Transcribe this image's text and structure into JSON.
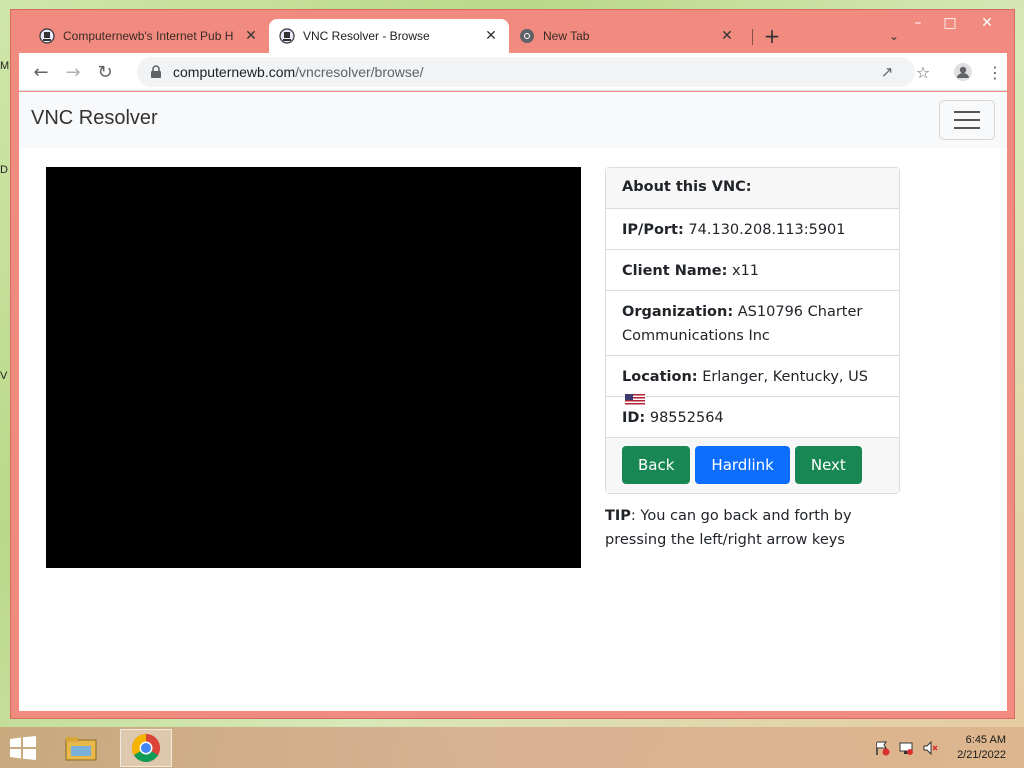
{
  "browser": {
    "tabs": [
      {
        "title": "Computernewb's Internet Pub H",
        "icon": "computernewb-icon",
        "active": false
      },
      {
        "title": "VNC Resolver - Browse",
        "icon": "computernewb-icon",
        "active": true
      },
      {
        "title": "New Tab",
        "icon": "chrome-icon",
        "active": false
      }
    ],
    "url_host": "computernewb.com",
    "url_path": "/vncresolver/browse/"
  },
  "navbar": {
    "brand": "VNC Resolver"
  },
  "card": {
    "header": "About this VNC:",
    "ip_label": "IP/Port:",
    "ip_value": "74.130.208.113:5901",
    "client_label": "Client Name:",
    "client_value": "x11",
    "org_label": "Organization:",
    "org_value": "AS10796 Charter Communications Inc",
    "location_label": "Location:",
    "location_value": "Erlanger, Kentucky, US",
    "id_label": "ID:",
    "id_value": "98552564",
    "buttons": {
      "back": "Back",
      "hardlink": "Hardlink",
      "next": "Next"
    }
  },
  "tip": {
    "label": "TIP",
    "text": ": You can go back and forth by pressing the left/right arrow keys"
  },
  "taskbar": {
    "time": "6:45 AM",
    "date": "2/21/2022"
  },
  "desktop": {
    "edge_letters": [
      "M",
      "D",
      "V"
    ]
  },
  "colors": {
    "window_frame": "#f28b7f",
    "btn_success": "#198754",
    "btn_primary": "#0d6efd"
  }
}
